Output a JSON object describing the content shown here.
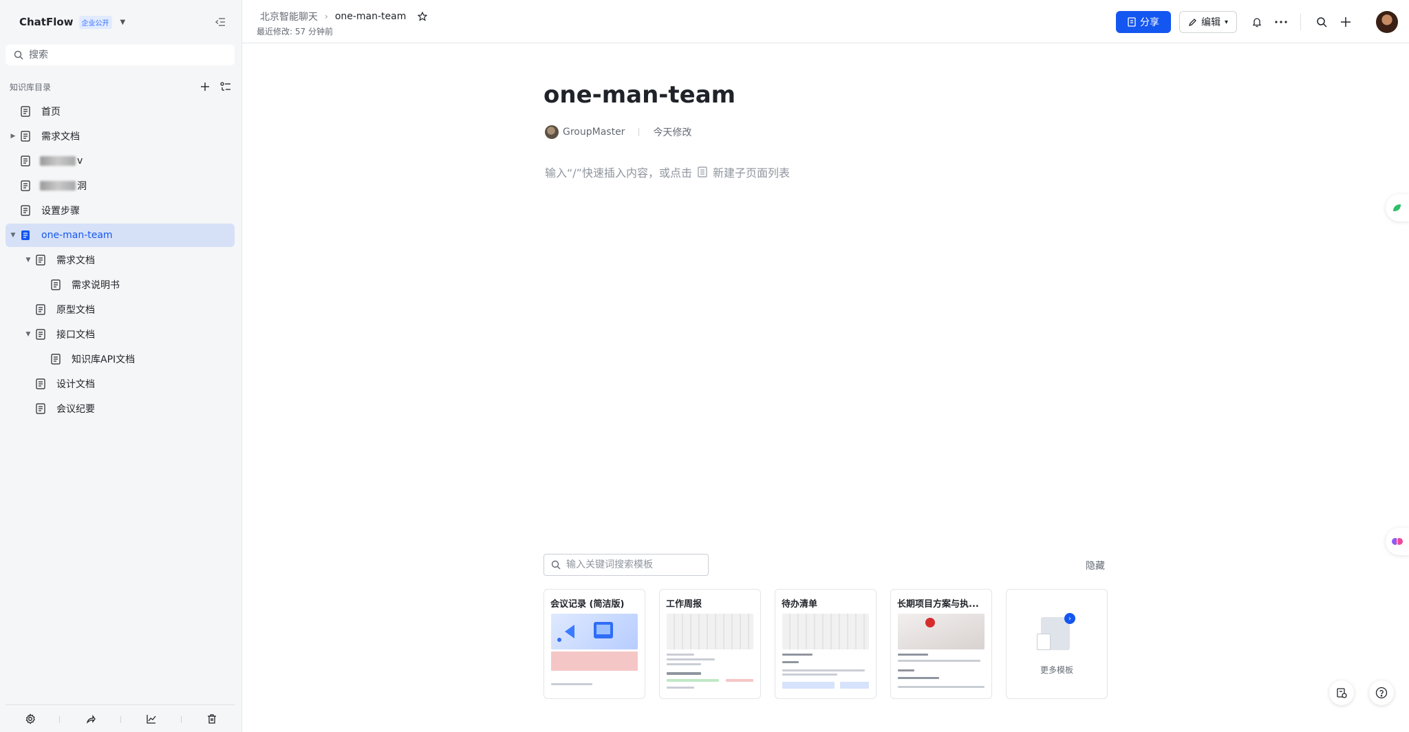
{
  "app": {
    "name": "ChatFlow",
    "badge": "企业公开"
  },
  "sidebar": {
    "search_placeholder": "搜索",
    "section_title": "知识库目录",
    "items": [
      {
        "label": "首页",
        "level": 0,
        "arrow": "none"
      },
      {
        "label": "需求文档",
        "level": 0,
        "arrow": "collapsed"
      },
      {
        "label": "v",
        "level": 0,
        "arrow": "none",
        "blurred": true
      },
      {
        "label": "洞",
        "level": 0,
        "arrow": "none",
        "blurred": true
      },
      {
        "label": "设置步骤",
        "level": 0,
        "arrow": "none"
      },
      {
        "label": "one-man-team",
        "level": 0,
        "arrow": "expanded",
        "active": true
      },
      {
        "label": "需求文档",
        "level": 1,
        "arrow": "expanded"
      },
      {
        "label": "需求说明书",
        "level": 2,
        "arrow": "none"
      },
      {
        "label": "原型文档",
        "level": 1,
        "arrow": "none"
      },
      {
        "label": "接口文档",
        "level": 1,
        "arrow": "expanded"
      },
      {
        "label": "知识库API文档",
        "level": 2,
        "arrow": "none"
      },
      {
        "label": "设计文档",
        "level": 1,
        "arrow": "none"
      },
      {
        "label": "会议纪要",
        "level": 1,
        "arrow": "none"
      }
    ]
  },
  "topbar": {
    "breadcrumb_parent": "北京智能聊天",
    "breadcrumb_current": "one-man-team",
    "last_modified": "最近修改: 57 分钟前",
    "share_label": "分享",
    "edit_label": "编辑"
  },
  "document": {
    "title": "one-man-team",
    "author": "GroupMaster",
    "modified": "今天修改",
    "placeholder_prefix": "输入“/”快速插入内容，或点击",
    "placeholder_suffix": "新建子页面列表"
  },
  "templates": {
    "search_placeholder": "输入关键词搜索模板",
    "hide_label": "隐藏",
    "cards": [
      {
        "title": "会议记录 (简洁版)",
        "thumb": "blue"
      },
      {
        "title": "工作周报",
        "thumb": "gray"
      },
      {
        "title": "待办清单",
        "thumb": "gray"
      },
      {
        "title": "长期项目方案与执...",
        "thumb": "photo"
      }
    ],
    "more_label": "更多模板"
  },
  "colors": {
    "accent": "#1456f0",
    "active_bg": "#d6e1f8",
    "sidebar_bg": "#f5f6f7"
  }
}
